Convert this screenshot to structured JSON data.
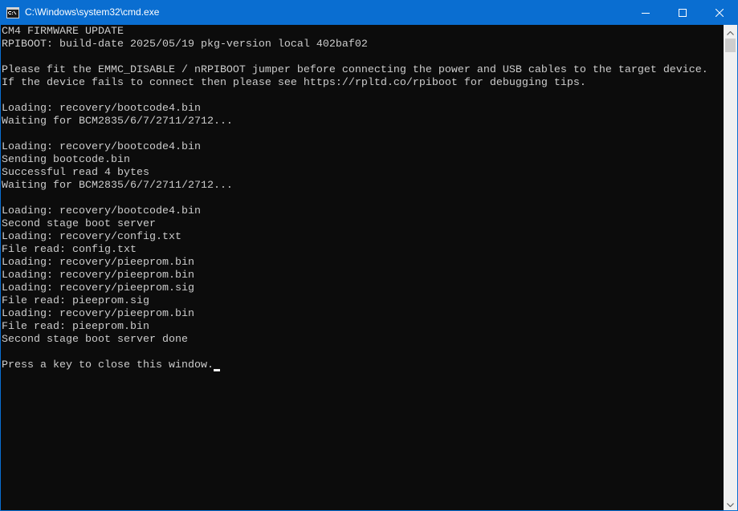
{
  "window": {
    "title": "C:\\Windows\\system32\\cmd.exe",
    "app_icon": "cmd-icon",
    "controls": {
      "minimize": "minimize-icon",
      "maximize": "maximize-icon",
      "close": "close-icon"
    }
  },
  "console": {
    "lines": [
      "CM4 FIRMWARE UPDATE",
      "RPIBOOT: build-date 2025/05/19 pkg-version local 402baf02",
      "",
      "Please fit the EMMC_DISABLE / nRPIBOOT jumper before connecting the power and USB cables to the target device.",
      "If the device fails to connect then please see https://rpltd.co/rpiboot for debugging tips.",
      "",
      "Loading: recovery/bootcode4.bin",
      "Waiting for BCM2835/6/7/2711/2712...",
      "",
      "Loading: recovery/bootcode4.bin",
      "Sending bootcode.bin",
      "Successful read 4 bytes",
      "Waiting for BCM2835/6/7/2711/2712...",
      "",
      "Loading: recovery/bootcode4.bin",
      "Second stage boot server",
      "Loading: recovery/config.txt",
      "File read: config.txt",
      "Loading: recovery/pieeprom.bin",
      "Loading: recovery/pieeprom.bin",
      "Loading: recovery/pieeprom.sig",
      "File read: pieeprom.sig",
      "Loading: recovery/pieeprom.bin",
      "File read: pieeprom.bin",
      "Second stage boot server done",
      "",
      "Press a key to close this window."
    ]
  },
  "scrollbar": {
    "up_icon": "chevron-up-icon",
    "down_icon": "chevron-down-icon",
    "scroll_fraction": 0
  },
  "colors": {
    "title_bar": "#0a6ed1",
    "console_background": "#0c0c0c",
    "console_text": "#cccccc",
    "scrollbar_track": "#f0f0f0",
    "scrollbar_thumb": "#cdcdcd"
  }
}
